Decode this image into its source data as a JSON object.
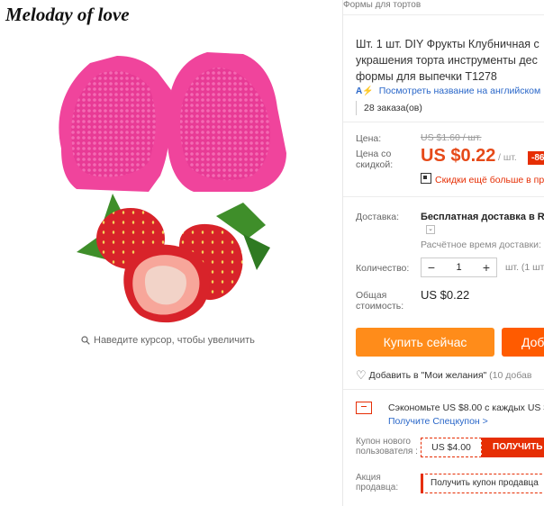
{
  "product_image": {
    "brand": "Meloday of love",
    "zoom_hint": "Наведите курсор, чтобы увеличить"
  },
  "breadcrumb": "Формы для тортов",
  "product": {
    "title_line1": "Шт. 1 шт. DIY Фрукты Клубничная с",
    "title_line2": "украшения торта инструменты дес",
    "title_line3": "формы для выпечки T1278",
    "translate_badge": "A⚡",
    "translate_link": "Посмотреть название на английском",
    "orders": "28 заказа(ов)"
  },
  "pricing": {
    "price_label": "Цена:",
    "old_price": "US $1.60 / шт.",
    "discount_label_1": "Цена со",
    "discount_label_2": "скидкой:",
    "price": "US $0.22",
    "per_unit": "/ шт.",
    "discount_badge": "-86%",
    "promo": "Скидки ещё больше в пр"
  },
  "shipping": {
    "label": "Доставка:",
    "value": "Бесплатная доставка в Ru",
    "estimate": "Расчётное время доставки:"
  },
  "quantity": {
    "label": "Количество:",
    "minus": "−",
    "value": "1",
    "plus": "+",
    "units": "шт. (1 шт"
  },
  "total": {
    "label_1": "Общая",
    "label_2": "стоимость:",
    "value": "US $0.22"
  },
  "actions": {
    "buy_now": "Купить сейчас",
    "add_to_cart": "Доб",
    "wishlist": "Добавить в \"Мои желания\"",
    "wishlist_count": "(10 добав"
  },
  "coupons": {
    "save_text": "Сэкономьте US $8.00 с каждых US $",
    "save_link": "Получите Спецкупон >",
    "new_user_label": "Купон нового пользователя :",
    "new_user_value": "US $4.00",
    "new_user_button": "ПОЛУЧИТЬ",
    "seller_label": "Акция продавца:",
    "seller_button": "Получить купон продавца"
  },
  "colors": {
    "accent_orange": "#ff8c1a",
    "accent_red": "#e62e04",
    "link_blue": "#2a67c9",
    "mold_pink": "#f0449c"
  }
}
